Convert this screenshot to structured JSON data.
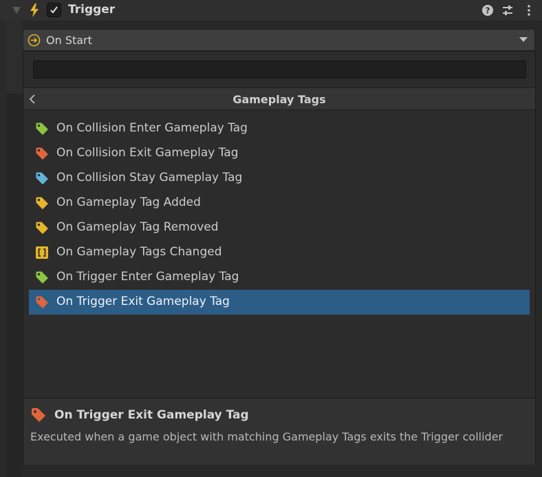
{
  "header": {
    "title": "Trigger",
    "enabled": true,
    "icons": [
      "foldout-arrow-icon",
      "lightning-bolt-icon",
      "checkbox-icon",
      "help-icon",
      "preset-sliders-icon",
      "more-options-icon"
    ]
  },
  "dropdown": {
    "selected": "On Start",
    "icon": "enter-circle-icon"
  },
  "popup": {
    "search": {
      "value": "",
      "placeholder": ""
    },
    "nav_title": "Gameplay Tags",
    "items": [
      {
        "label": "On Collision Enter Gameplay Tag",
        "icon": "tag-icon",
        "color": "#8cc63f"
      },
      {
        "label": "On Collision Exit Gameplay Tag",
        "icon": "tag-icon",
        "color": "#e0663a"
      },
      {
        "label": "On Collision Stay Gameplay Tag",
        "icon": "tag-icon",
        "color": "#5fb4d9"
      },
      {
        "label": "On Gameplay Tag Added",
        "icon": "tag-icon",
        "color": "#e5b52a"
      },
      {
        "label": "On Gameplay Tag Removed",
        "icon": "tag-icon",
        "color": "#e5b52a"
      },
      {
        "label": "On Gameplay Tags Changed",
        "icon": "brackets-icon",
        "color": "#e5b52a"
      },
      {
        "label": "On Trigger Enter Gameplay Tag",
        "icon": "tag-icon",
        "color": "#8cc63f"
      },
      {
        "label": "On Trigger Exit Gameplay Tag",
        "icon": "tag-icon",
        "color": "#e0663a",
        "selected": true
      }
    ],
    "details": {
      "title": "On Trigger Exit Gameplay Tag",
      "description": "Executed when a game object with matching Gameplay Tags exits the Trigger collider",
      "icon": "tag-icon",
      "color": "#e0663a"
    }
  },
  "colors": {
    "selection": "#2c5d87",
    "accent_yellow": "#e5b52a"
  }
}
